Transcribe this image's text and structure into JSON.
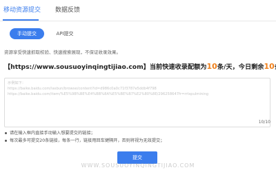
{
  "tabs": [
    {
      "label": "移动资源提交",
      "active": true
    },
    {
      "label": "数据反馈",
      "active": false
    }
  ],
  "subtabs": [
    {
      "label": "手动提交",
      "active": true
    },
    {
      "label": "API提交",
      "active": false
    }
  ],
  "description": "资源享受快速抓取校验、快速搜索展现，不保证收录效果。",
  "banner": {
    "prefix": "【https://www.sousuoyinqingtijiao.com】当前快速收录配额为",
    "quota": "10",
    "middle": "条/天，今日剩余",
    "remaining": "10",
    "suffix": "条"
  },
  "textarea": {
    "lines": [
      "示例如下：",
      "https://baike.baidu.com/lasbun/browse/content?id=d986c0a0c71f3787e5ddb4f798",
      "https://baike.baidu.com/item/%E5%9B%BE%E4%BB%8A%E5%BE%B7%E2%80%8E/296258647fr=rrtspulmining"
    ],
    "counter": "10/10"
  },
  "rules": [
    "请在输入框内直接手动输入想要提交的链接；",
    "每次最多可提交20条链接，每条一行，链接用回车键隔开，否则将视为无效提交；"
  ],
  "submit_label": "提交",
  "watermark": "WWW.SOUSUOYINQINGTIJIAO.COM",
  "colors": {
    "accent": "#3b7ded",
    "highlight": "#ef7f1a"
  }
}
